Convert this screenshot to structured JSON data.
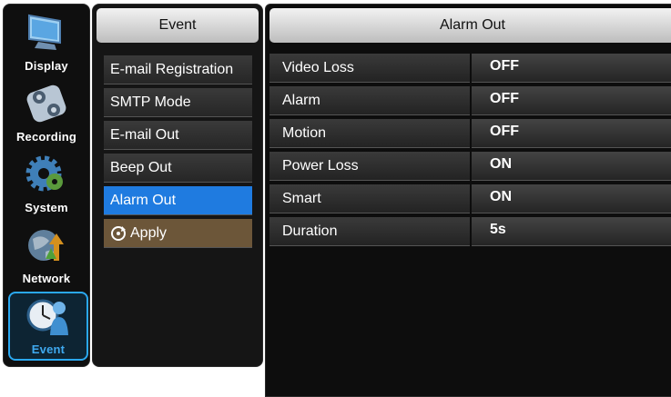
{
  "sidebar": {
    "items": [
      {
        "label": "Display",
        "icon": "monitor-icon"
      },
      {
        "label": "Recording",
        "icon": "film-reel-icon"
      },
      {
        "label": "System",
        "icon": "gear-icon"
      },
      {
        "label": "Network",
        "icon": "globe-network-icon"
      },
      {
        "label": "Event",
        "icon": "clock-person-icon",
        "selected": true
      }
    ]
  },
  "menu": {
    "title": "Event",
    "items": [
      {
        "label": "E-mail Registration"
      },
      {
        "label": "SMTP Mode"
      },
      {
        "label": "E-mail Out"
      },
      {
        "label": "Beep Out"
      },
      {
        "label": "Alarm Out",
        "selected": true
      },
      {
        "label": "Apply",
        "icon": "refresh-icon"
      }
    ]
  },
  "panel": {
    "title": "Alarm Out",
    "rows": [
      {
        "label": "Video Loss",
        "value": "OFF"
      },
      {
        "label": "Alarm",
        "value": "OFF"
      },
      {
        "label": "Motion",
        "value": "OFF"
      },
      {
        "label": "Power Loss",
        "value": "ON"
      },
      {
        "label": "Smart",
        "value": "ON"
      },
      {
        "label": "Duration",
        "value": "5s"
      }
    ]
  },
  "colors": {
    "selected_blue": "#1f7be0",
    "apply_brown": "#6c5639",
    "event_accent": "#3fa9ef"
  }
}
